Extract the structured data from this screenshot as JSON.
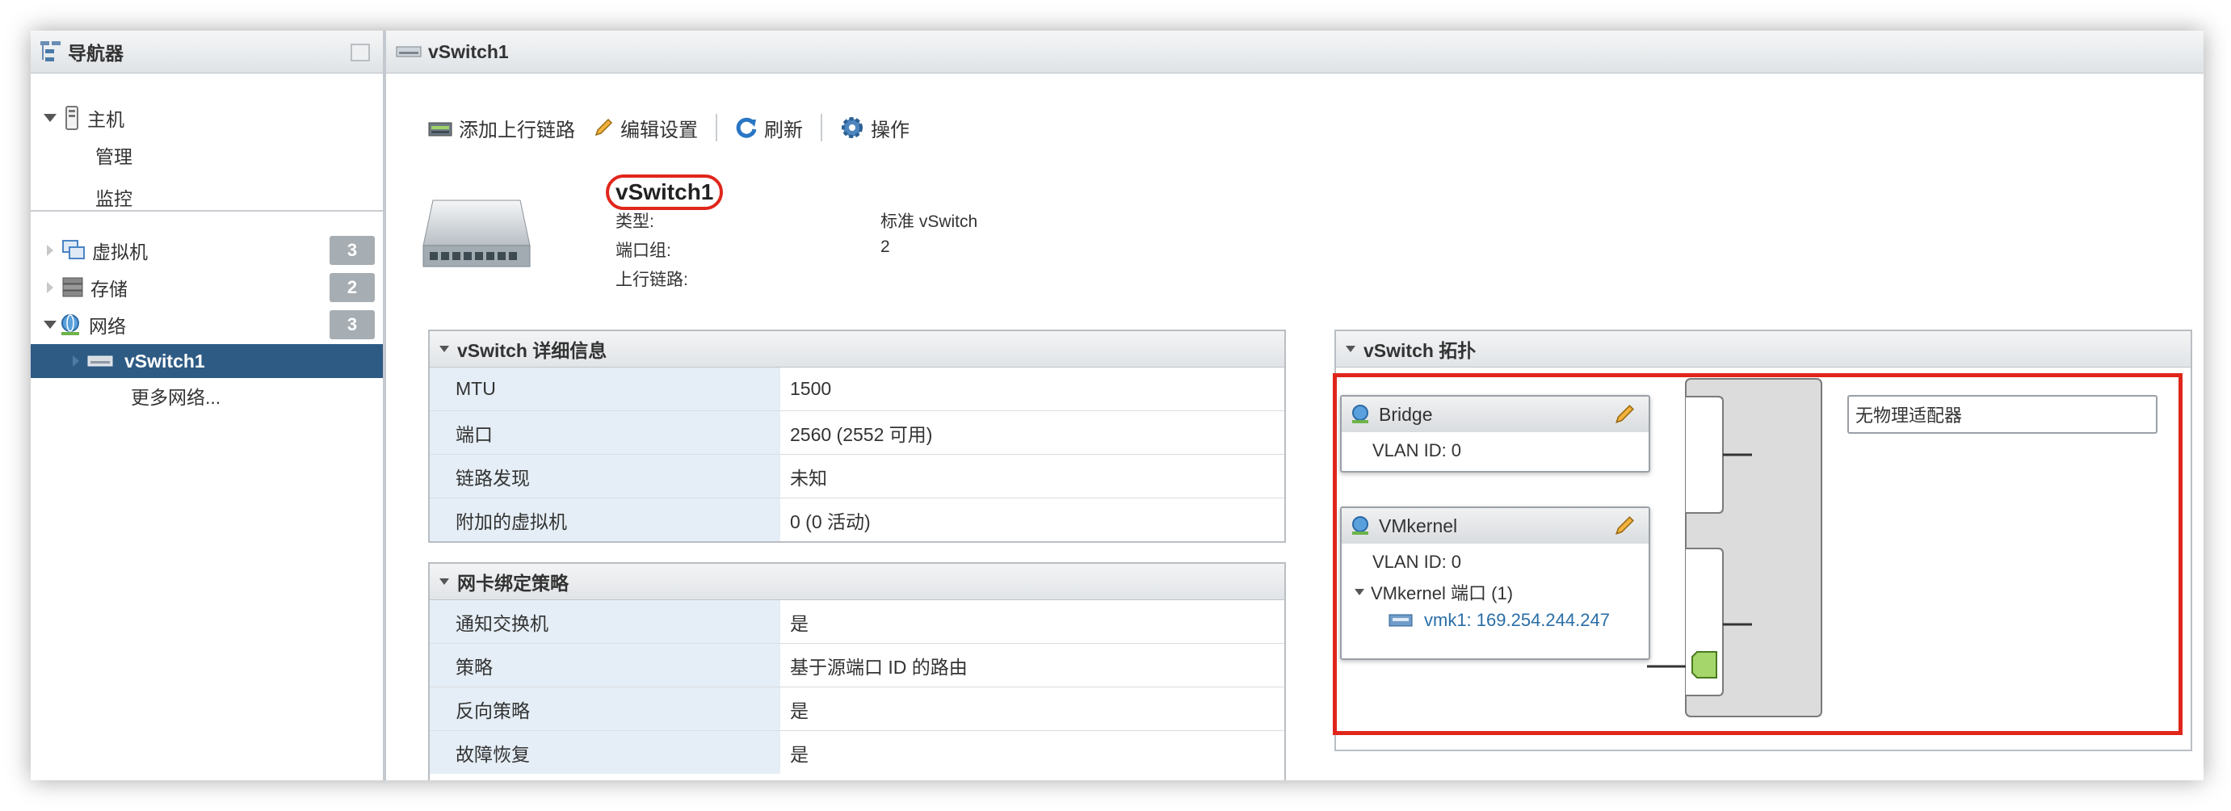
{
  "navigator": {
    "title": "导航器",
    "host": "主机",
    "manage": "管理",
    "monitor": "监控",
    "vms": {
      "label": "虚拟机",
      "count": "3"
    },
    "storage": {
      "label": "存储",
      "count": "2"
    },
    "network": {
      "label": "网络",
      "count": "3"
    },
    "vswitch": "vSwitch1",
    "more_networks": "更多网络..."
  },
  "header": {
    "title": "vSwitch1"
  },
  "toolbar": {
    "add_uplink": "添加上行链路",
    "edit_settings": "编辑设置",
    "refresh": "刷新",
    "actions": "操作"
  },
  "summary": {
    "name": "vSwitch1",
    "type_label": "类型:",
    "type_value": "标准 vSwitch",
    "portgroups_label": "端口组:",
    "portgroups_value": "2",
    "uplinks_label": "上行链路:"
  },
  "details": {
    "title": "vSwitch 详细信息",
    "rows": [
      {
        "k": "MTU",
        "v": "1500"
      },
      {
        "k": "端口",
        "v": "2560 (2552 可用)"
      },
      {
        "k": "链路发现",
        "v": "未知"
      },
      {
        "k": "附加的虚拟机",
        "v": "0 (0 活动)"
      }
    ]
  },
  "nic_teaming": {
    "title": "网卡绑定策略",
    "rows": [
      {
        "k": "通知交换机",
        "v": "是"
      },
      {
        "k": "策略",
        "v": "基于源端口 ID 的路由"
      },
      {
        "k": "反向策略",
        "v": "是"
      },
      {
        "k": "故障恢复",
        "v": "是"
      }
    ]
  },
  "topology": {
    "title": "vSwitch 拓扑",
    "bridge": {
      "name": "Bridge",
      "vlan": "VLAN ID: 0"
    },
    "vmkernel": {
      "name": "VMkernel",
      "vlan": "VLAN ID: 0",
      "ports": "VMkernel 端口 (1)",
      "vmk": "vmk1: 169.254.244.247"
    },
    "no_adapter": "无物理适配器"
  },
  "colors": {
    "accent": "#2e5b84",
    "highlight": "#e0261b",
    "link": "#2a6ea6"
  }
}
